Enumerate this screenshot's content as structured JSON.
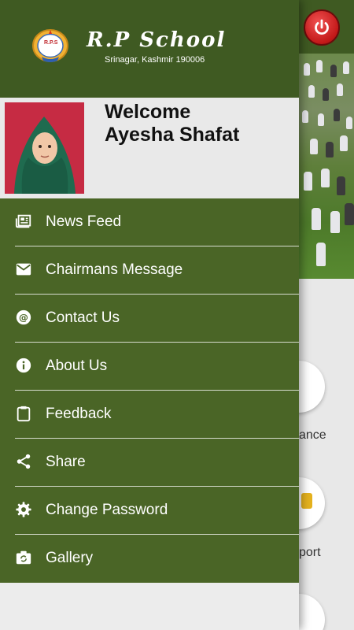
{
  "header": {
    "school_name": "R.P School",
    "school_address": "Srinagar, Kashmir 190006",
    "logo_icon": "school-logo-icon",
    "logo_text": "R.P.S"
  },
  "profile": {
    "welcome": "Welcome",
    "user_name": "Ayesha Shafat"
  },
  "menu": {
    "items": [
      {
        "label": "News Feed",
        "icon": "newspaper-icon"
      },
      {
        "label": "Chairmans Message",
        "icon": "mail-icon"
      },
      {
        "label": "Contact Us",
        "icon": "at-icon"
      },
      {
        "label": "About Us",
        "icon": "info-icon"
      },
      {
        "label": "Feedback",
        "icon": "clipboard-icon"
      },
      {
        "label": "Share",
        "icon": "share-icon"
      },
      {
        "label": "Change Password",
        "icon": "gear-icon"
      },
      {
        "label": "Gallery",
        "icon": "camera-switch-icon"
      }
    ]
  },
  "background": {
    "label_attendance_partial": "ance",
    "label_transport_partial": "port"
  },
  "colors": {
    "header_green": "#3f5a22",
    "menu_green": "#4a6526",
    "power_red": "#d32020"
  }
}
